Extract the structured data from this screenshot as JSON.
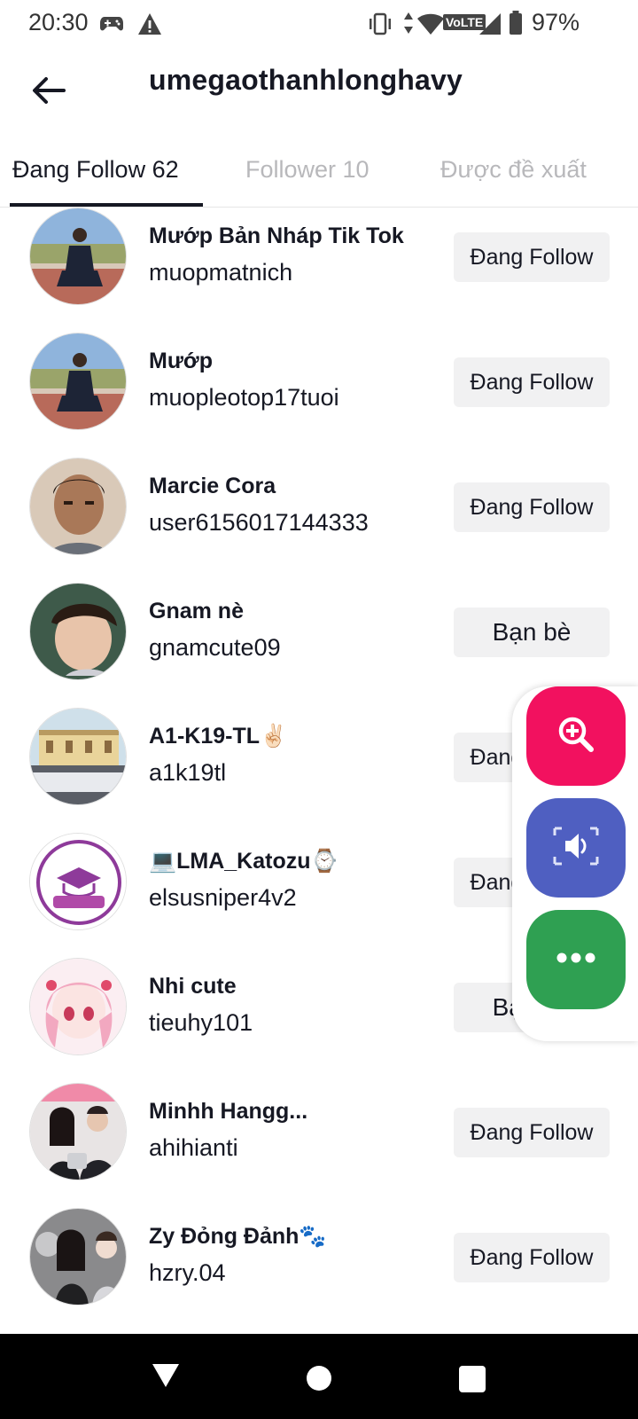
{
  "status_bar": {
    "time": "20:30",
    "network": "VoLTE",
    "battery": "97%",
    "icons": [
      "game-controller-icon",
      "warning-icon",
      "vibrate-icon",
      "data-arrows-icon",
      "wifi-icon",
      "signal-icon",
      "battery-icon"
    ]
  },
  "header": {
    "title": "umegaothanhlonghavy"
  },
  "tabs": [
    {
      "label": "Đang Follow 62",
      "active": true
    },
    {
      "label": "Follower 10",
      "active": false
    },
    {
      "label": "Được đề xuất",
      "active": false
    }
  ],
  "users": [
    {
      "name": "Mướp Bản Nháp Tik Tok",
      "handle": "muopmatnich",
      "button": "Đang Follow"
    },
    {
      "name": "Mướp",
      "handle": "muopleotop17tuoi",
      "button": "Đang Follow"
    },
    {
      "name": "Marcie Cora",
      "handle": "user6156017144333",
      "button": "Đang Follow"
    },
    {
      "name": "Gnam nè",
      "handle": "gnamcute09",
      "button": "Bạn bè"
    },
    {
      "name": "A1-K19-TL✌🏻",
      "handle": "a1k19tl",
      "button": "Đang Follow"
    },
    {
      "name": "💻LMA_Katozu⌚",
      "handle": "elsusniper4v2",
      "button": "Đang Follow"
    },
    {
      "name": "Nhi cute",
      "handle": "tieuhy101",
      "button": "Bạn bè"
    },
    {
      "name": "Minhh Hangg...",
      "handle": "ahihianti",
      "button": "Đang Follow"
    },
    {
      "name": "Zy Đỏng Đảnh🐾",
      "handle": "hzry.04",
      "button": "Đang Follow"
    }
  ],
  "floating_panel": {
    "buttons": [
      {
        "icon": "zoom-in-icon",
        "color": "#f2115f"
      },
      {
        "icon": "speaker-icon",
        "color": "#4f5fc1"
      },
      {
        "icon": "more-icon",
        "color": "#2fa052"
      }
    ]
  },
  "colors": {
    "text": "#161823",
    "muted_tab": "#b8b8bb",
    "button_bg": "#f1f1f2"
  }
}
